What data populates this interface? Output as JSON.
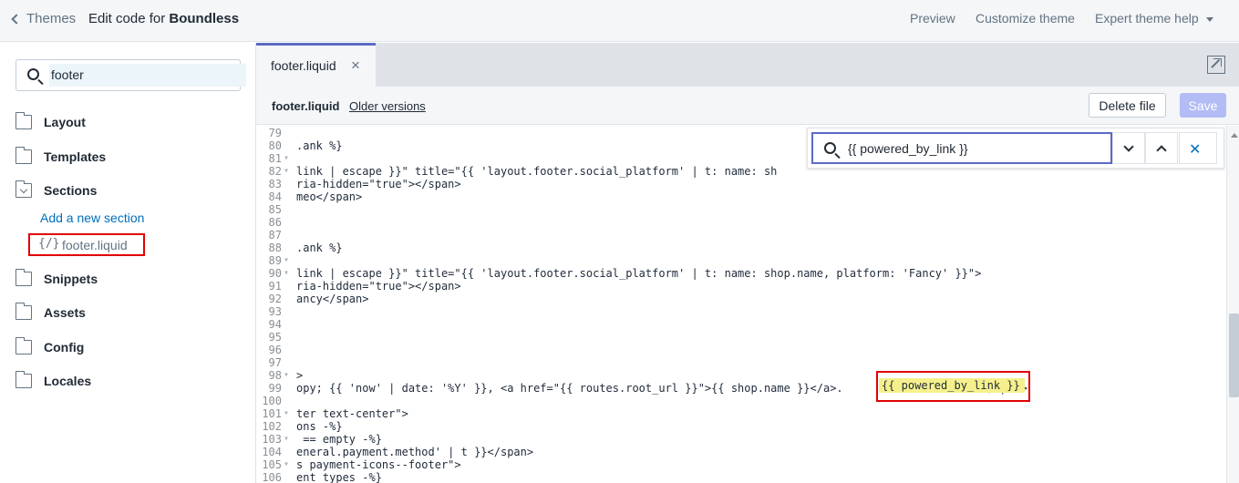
{
  "topbar": {
    "back_label": "Themes",
    "title_prefix": "Edit code for ",
    "title_theme": "Boundless",
    "preview": "Preview",
    "customize": "Customize theme",
    "help": "Expert theme help"
  },
  "sidebar": {
    "search_value": "footer",
    "folders": {
      "layout": "Layout",
      "templates": "Templates",
      "sections": "Sections",
      "snippets": "Snippets",
      "assets": "Assets",
      "config": "Config",
      "locales": "Locales"
    },
    "add_section": "Add a new section",
    "file_icon": "{/}",
    "file_name": "footer.liquid"
  },
  "editor": {
    "tab_label": "footer.liquid",
    "tab_close": "×",
    "file_name": "footer.liquid",
    "older_versions": "Older versions",
    "delete_label": "Delete file",
    "save_label": "Save",
    "find_value": "{{ powered_by_link }}",
    "find_close": "✕",
    "highlight_text": "{{ powered_by_link }}",
    "lines": [
      {
        "n": "79",
        "t": ""
      },
      {
        "n": "80",
        "t": ".ank %}"
      },
      {
        "n": "81",
        "t": ""
      },
      {
        "n": "82",
        "t": "link | escape }}\" title=\"{{ 'layout.footer.social_platform' | t: name: sh"
      },
      {
        "n": "83",
        "t": "ria-hidden=\"true\"></span>"
      },
      {
        "n": "84",
        "t": "meo</span>"
      },
      {
        "n": "85",
        "t": ""
      },
      {
        "n": "86",
        "t": ""
      },
      {
        "n": "87",
        "t": ""
      },
      {
        "n": "88",
        "t": ".ank %}"
      },
      {
        "n": "89",
        "t": ""
      },
      {
        "n": "90",
        "t": "link | escape }}\" title=\"{{ 'layout.footer.social_platform' | t: name: shop.name, platform: 'Fancy' }}\">"
      },
      {
        "n": "91",
        "t": "ria-hidden=\"true\"></span>"
      },
      {
        "n": "92",
        "t": "ancy</span>"
      },
      {
        "n": "93",
        "t": ""
      },
      {
        "n": "94",
        "t": ""
      },
      {
        "n": "95",
        "t": ""
      },
      {
        "n": "96",
        "t": ""
      },
      {
        "n": "97",
        "t": ""
      },
      {
        "n": "98",
        "t": ">"
      },
      {
        "n": "99",
        "t": "opy; {{ 'now' | date: '%Y' }}, <a href=\"{{ routes.root_url }}\">{{ shop.name }}</a>.                     </span>"
      },
      {
        "n": "100",
        "t": ""
      },
      {
        "n": "101",
        "t": "ter text-center\">"
      },
      {
        "n": "102",
        "t": "ons -%}"
      },
      {
        "n": "103",
        "t": " == empty -%}"
      },
      {
        "n": "104",
        "t": "eneral.payment.method' | t }}</span>"
      },
      {
        "n": "105",
        "t": "s payment-icons--footer\">"
      },
      {
        "n": "106",
        "t": "ent_types -%}"
      }
    ]
  }
}
